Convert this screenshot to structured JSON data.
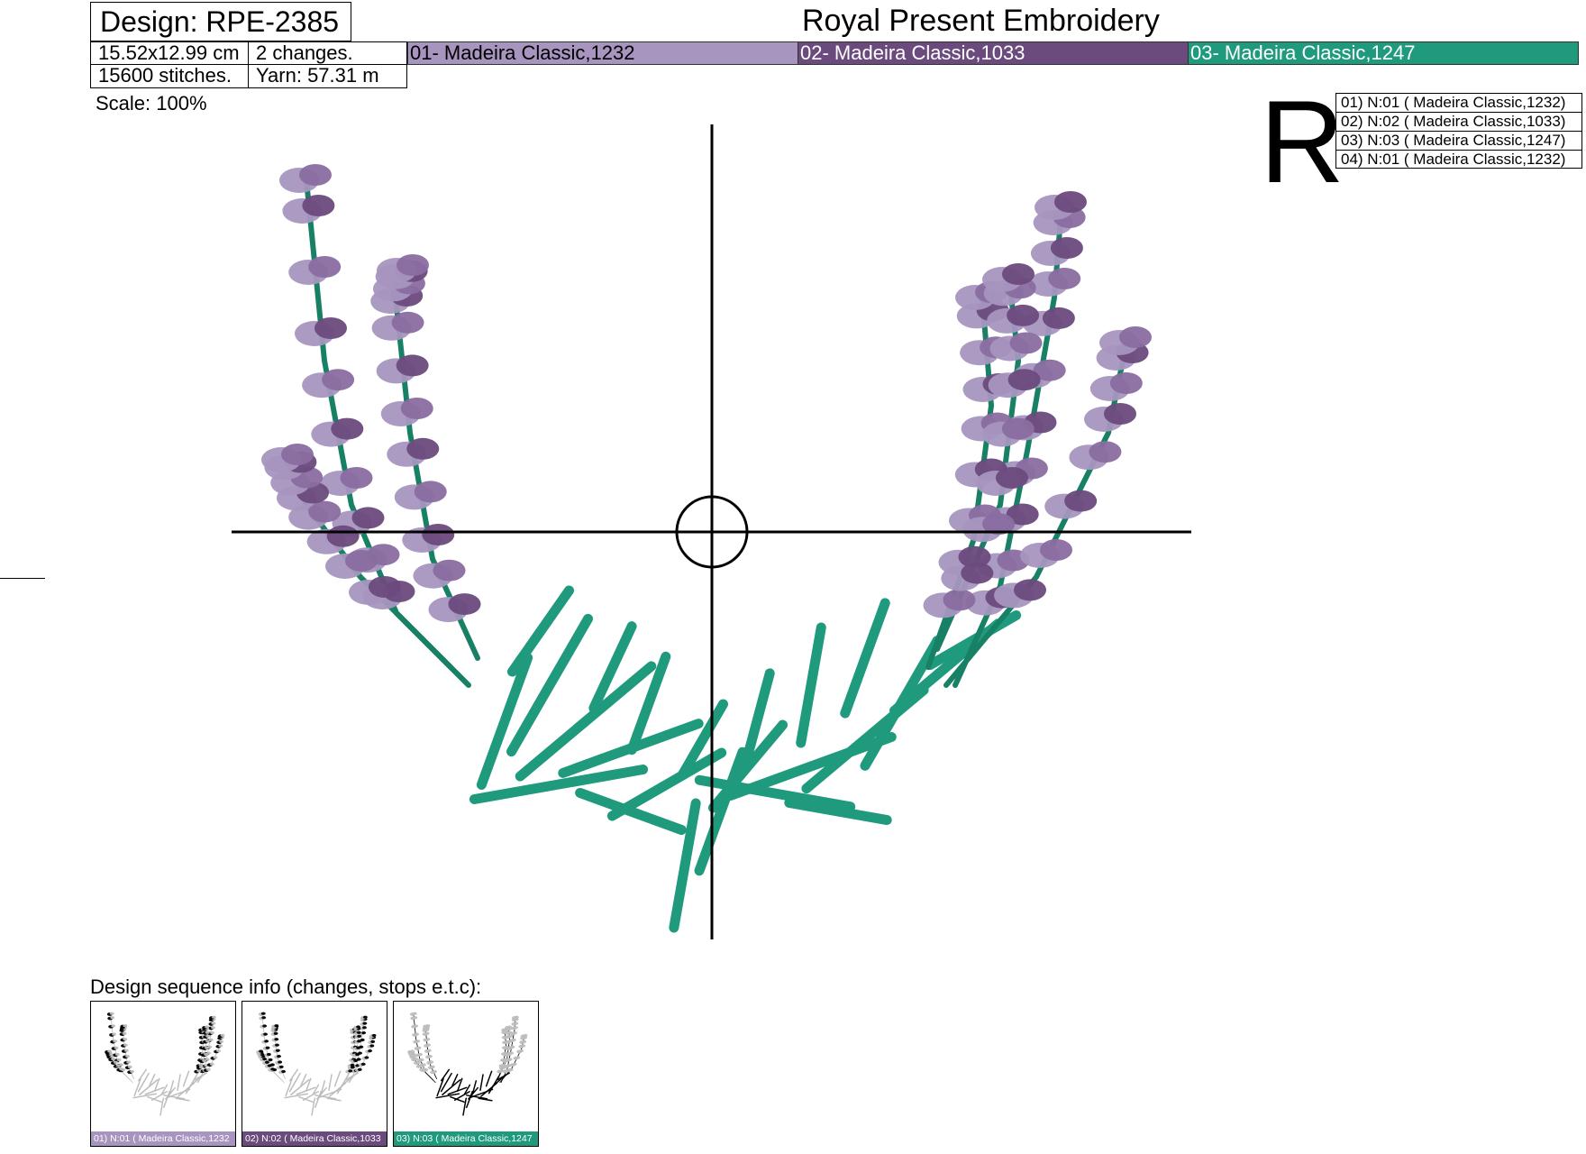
{
  "header": {
    "design_id": "Design: RPE-2385",
    "company": "Royal Present Embroidery"
  },
  "specs": {
    "size": "15.52x12.99 cm",
    "changes": "2 changes.",
    "stitches": "15600 stitches.",
    "yarn": "Yarn: 57.31 m"
  },
  "threads": [
    {
      "label": "01- Madeira Classic,1232",
      "color": "#a795bf",
      "text_color": "#000000"
    },
    {
      "label": "02- Madeira Classic,1033",
      "color": "#6b4a7d",
      "text_color": "#ffffff"
    },
    {
      "label": "03- Madeira Classic,1247",
      "color": "#1f9a7d",
      "text_color": "#ffffff"
    }
  ],
  "scale": "Scale: 100%",
  "rotate_letter": "R",
  "stop_sequence": [
    "01) N:01 ( Madeira Classic,1232)",
    "02) N:02 ( Madeira Classic,1033)",
    "03) N:03 ( Madeira Classic,1247)",
    "04) N:01 ( Madeira Classic,1232)"
  ],
  "sequence": {
    "title": "Design sequence info (changes, stops e.t.c):",
    "thumbnails": [
      {
        "label": "01) N:01 ( Madeira Classic,1232",
        "color": "#a795bf",
        "highlight": "flowers-light"
      },
      {
        "label": "02) N:02 ( Madeira Classic,1033",
        "color": "#6b4a7d",
        "highlight": "flowers-dark"
      },
      {
        "label": "03) N:03 ( Madeira Classic,1247",
        "color": "#1f9a7d",
        "highlight": "leaves"
      }
    ]
  },
  "colors": {
    "lavender_light": "#a795bf",
    "lavender_mid": "#8a6da0",
    "lavender_dark": "#6b4a7d",
    "leaf_green": "#1f9a7d",
    "leaf_dark": "#178065"
  }
}
